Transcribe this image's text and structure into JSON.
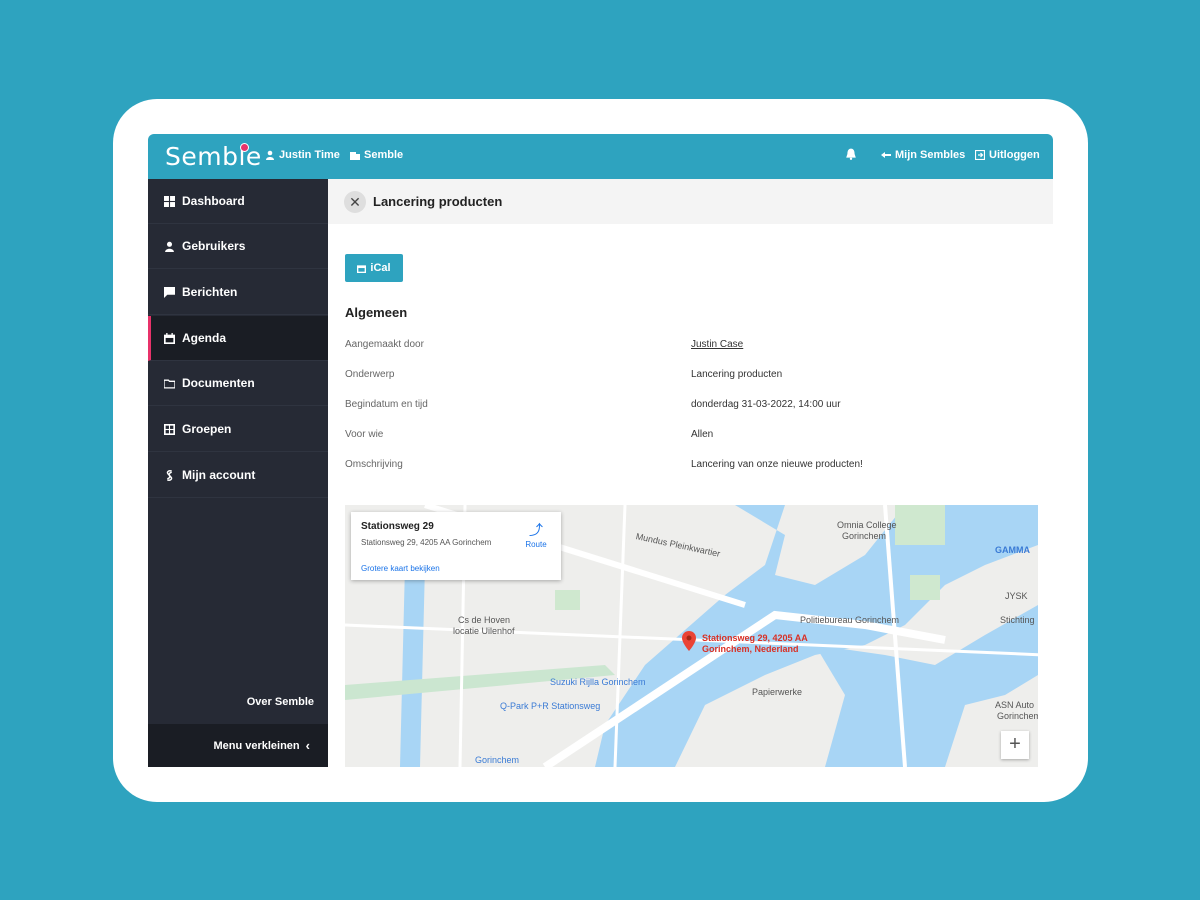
{
  "header": {
    "logo": "Semble",
    "user": "Justin Time",
    "org": "Semble",
    "mijn_sembles": "Mijn Sembles",
    "logout": "Uitloggen"
  },
  "sidebar": {
    "items": [
      {
        "label": "Dashboard",
        "icon": "dashboard-icon"
      },
      {
        "label": "Gebruikers",
        "icon": "user-icon"
      },
      {
        "label": "Berichten",
        "icon": "message-icon"
      },
      {
        "label": "Agenda",
        "icon": "calendar-icon",
        "active": true
      },
      {
        "label": "Documenten",
        "icon": "folder-icon"
      },
      {
        "label": "Groepen",
        "icon": "groups-icon"
      },
      {
        "label": "Mijn account",
        "icon": "account-icon"
      }
    ],
    "about": "Over Semble",
    "collapse": "Menu verkleinen"
  },
  "event": {
    "title": "Lancering producten",
    "ical_label": "iCal",
    "section": "Algemeen",
    "fields": [
      {
        "label": "Aangemaakt door",
        "value": "Justin Case"
      },
      {
        "label": "Onderwerp",
        "value": "Lancering producten"
      },
      {
        "label": "Begindatum en tijd",
        "value": "donderdag 31-03-2022, 14:00 uur"
      },
      {
        "label": "Voor wie",
        "value": "Allen"
      },
      {
        "label": "Omschrijving",
        "value": "Lancering van onze nieuwe producten!"
      }
    ]
  },
  "map": {
    "card_title": "Stationsweg 29",
    "card_address": "Stationsweg 29, 4205 AA Gorinchem",
    "card_link": "Grotere kaart bekijken",
    "route_label": "Route",
    "pin_label_1": "Stationsweg 29, 4205 AA",
    "pin_label_2": "Gorinchem, Nederland",
    "places": {
      "college": "Omnia College",
      "college2": "Gorinchem",
      "gamma": "GAMMA",
      "police": "Politiebureau Gorinchem",
      "hoven": "Cs de Hoven",
      "hoven2": "locatie Uilenhof",
      "suzuki": "Suzuki Rijlla Gorinchem",
      "ppark": "Q-Park P+R Stationsweg",
      "station": "Gorinchem",
      "asn": "ASN Auto",
      "asn2": "Gorinchem",
      "papier": "Papierwerke",
      "mundus": "Mundus Pleinkwartier",
      "stichting": "Stichting",
      "jysk": "JYSK"
    },
    "zoom_in": "+"
  },
  "colors": {
    "brand": "#2ea3bf",
    "accent": "#e8336a",
    "sidebar": "#262a35",
    "water": "#9fd3f5"
  }
}
